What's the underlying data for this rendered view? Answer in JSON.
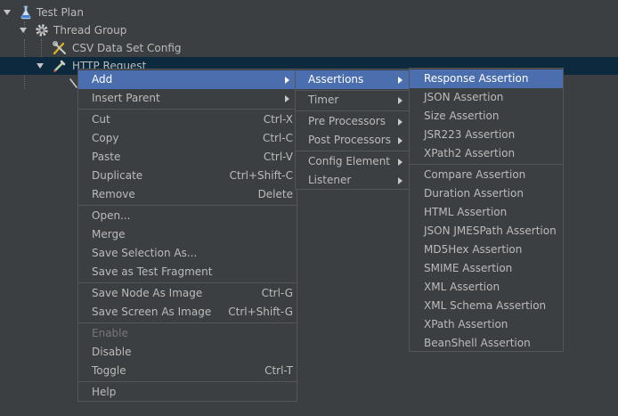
{
  "tree": {
    "test_plan": "Test Plan",
    "thread_group": "Thread Group",
    "csv_config": "CSV Data Set Config",
    "http_request": "HTTP Request"
  },
  "context_menu": {
    "add": "Add",
    "insert_parent": "Insert Parent",
    "cut": "Cut",
    "cut_shortcut": "Ctrl-X",
    "copy": "Copy",
    "copy_shortcut": "Ctrl-C",
    "paste": "Paste",
    "paste_shortcut": "Ctrl-V",
    "duplicate": "Duplicate",
    "duplicate_shortcut": "Ctrl+Shift-C",
    "remove": "Remove",
    "remove_shortcut": "Delete",
    "open": "Open...",
    "merge": "Merge",
    "save_selection_as": "Save Selection As...",
    "save_as_test_fragment": "Save as Test Fragment",
    "save_node_as_image": "Save Node As Image",
    "save_node_shortcut": "Ctrl-G",
    "save_screen_as_image": "Save Screen As Image",
    "save_screen_shortcut": "Ctrl+Shift-G",
    "enable": "Enable",
    "disable": "Disable",
    "toggle": "Toggle",
    "toggle_shortcut": "Ctrl-T",
    "help": "Help"
  },
  "add_submenu": {
    "assertions": "Assertions",
    "timer": "Timer",
    "pre_processors": "Pre Processors",
    "post_processors": "Post Processors",
    "config_element": "Config Element",
    "listener": "Listener"
  },
  "assertions_submenu": [
    "Response Assertion",
    "JSON Assertion",
    "Size Assertion",
    "JSR223 Assertion",
    "XPath2 Assertion",
    "Compare Assertion",
    "Duration Assertion",
    "HTML Assertion",
    "JSON JMESPath Assertion",
    "MD5Hex Assertion",
    "SMIME Assertion",
    "XML Assertion",
    "XML Schema Assertion",
    "XPath Assertion",
    "BeanShell Assertion"
  ],
  "colors": {
    "background": "#3c3f41",
    "text": "#bbbbbb",
    "highlight": "#4b6eaf",
    "selected_row": "#0d293e",
    "disabled_text": "#777777"
  }
}
